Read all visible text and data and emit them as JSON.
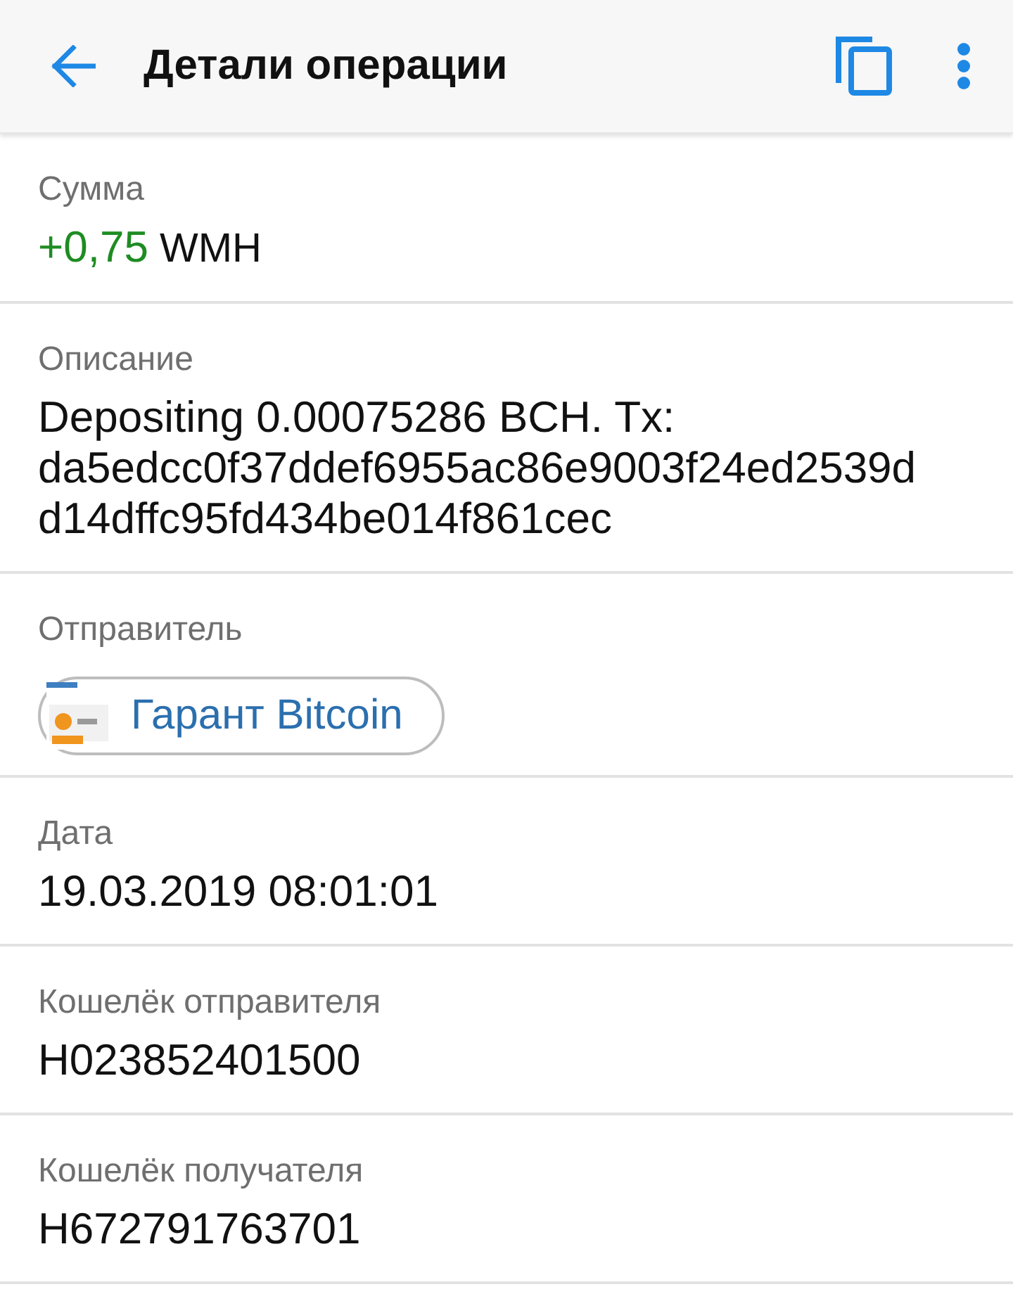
{
  "app_bar": {
    "title": "Детали операции"
  },
  "fields": [
    {
      "kind": "amount",
      "label": "Сумма",
      "amount": "+0,75",
      "currency": "WMH"
    },
    {
      "kind": "text",
      "label": "Описание",
      "value": "Depositing 0.00075286 BCH. Tx: da5edcc0f37ddef6955ac86e9003f24ed2539dd14dffc95fd434be014f861cec"
    },
    {
      "kind": "contact",
      "label": "Отправитель",
      "name": "Гарант Bitcoin"
    },
    {
      "kind": "text",
      "label": "Дата",
      "value": "19.03.2019 08:01:01"
    },
    {
      "kind": "text",
      "label": "Кошелёк отправителя",
      "value": "H023852401500"
    },
    {
      "kind": "text",
      "label": "Кошелёк получателя",
      "value": "H672791763701"
    }
  ]
}
